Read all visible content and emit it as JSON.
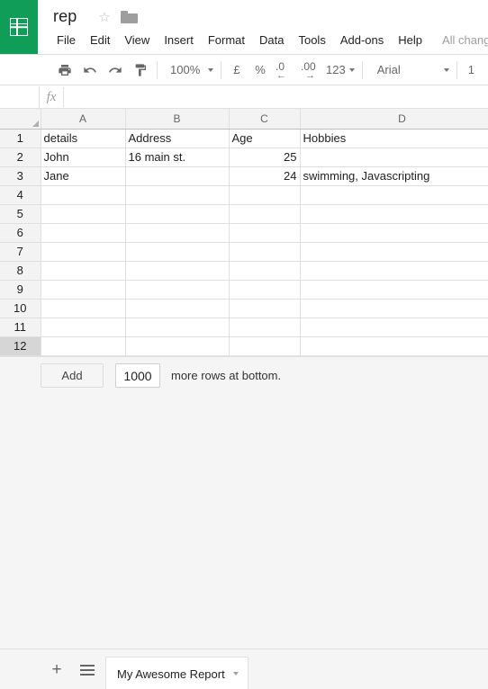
{
  "app": {
    "logo_icon": "sheets-grid-icon",
    "accent_color": "#0f9d58"
  },
  "header": {
    "doc_title": "rep",
    "star_icon": "star-outline-icon",
    "folder_icon": "folder-icon",
    "menus": [
      "File",
      "Edit",
      "View",
      "Insert",
      "Format",
      "Data",
      "Tools",
      "Add-ons",
      "Help"
    ],
    "save_status": "All chang"
  },
  "toolbar": {
    "print_icon": "print-icon",
    "undo_icon": "undo-icon",
    "redo_icon": "redo-icon",
    "paint_icon": "paint-format-icon",
    "zoom_value": "100%",
    "currency_label": "£",
    "percent_label": "%",
    "decrease_decimal_label": ".0",
    "decrease_decimal_arrow": "←",
    "increase_decimal_label": ".00",
    "increase_decimal_arrow": "→",
    "number_format_label": "123",
    "font_family_value": "Arial",
    "font_size_value": "1"
  },
  "formula_bar": {
    "fx_label": "fx",
    "value": "",
    "placeholder": ""
  },
  "grid": {
    "columns": [
      "A",
      "B",
      "C",
      "D"
    ],
    "rows": [
      {
        "number": "1",
        "cells": [
          "details",
          "Address",
          "Age",
          "Hobbies"
        ]
      },
      {
        "number": "2",
        "cells": [
          "John",
          "16 main st.",
          "25",
          ""
        ]
      },
      {
        "number": "3",
        "cells": [
          "Jane",
          "",
          "24",
          "swimming, Javascripting"
        ]
      },
      {
        "number": "4",
        "cells": [
          "",
          "",
          "",
          ""
        ]
      },
      {
        "number": "5",
        "cells": [
          "",
          "",
          "",
          ""
        ]
      },
      {
        "number": "6",
        "cells": [
          "",
          "",
          "",
          ""
        ]
      },
      {
        "number": "7",
        "cells": [
          "",
          "",
          "",
          ""
        ]
      },
      {
        "number": "8",
        "cells": [
          "",
          "",
          "",
          ""
        ]
      },
      {
        "number": "9",
        "cells": [
          "",
          "",
          "",
          ""
        ]
      },
      {
        "number": "10",
        "cells": [
          "",
          "",
          "",
          ""
        ]
      },
      {
        "number": "11",
        "cells": [
          "",
          "",
          "",
          ""
        ]
      },
      {
        "number": "12",
        "cells": [
          "",
          "",
          "",
          ""
        ]
      }
    ]
  },
  "add_rows": {
    "button_label": "Add",
    "count_value": "1000",
    "suffix_text": "more rows at bottom."
  },
  "sheet_tabs": {
    "add_sheet_icon": "plus-icon",
    "all_sheets_icon": "hamburger-menu-icon",
    "active_tab_name": "My Awesome Report",
    "tab_caret_icon": "chevron-down-icon"
  }
}
